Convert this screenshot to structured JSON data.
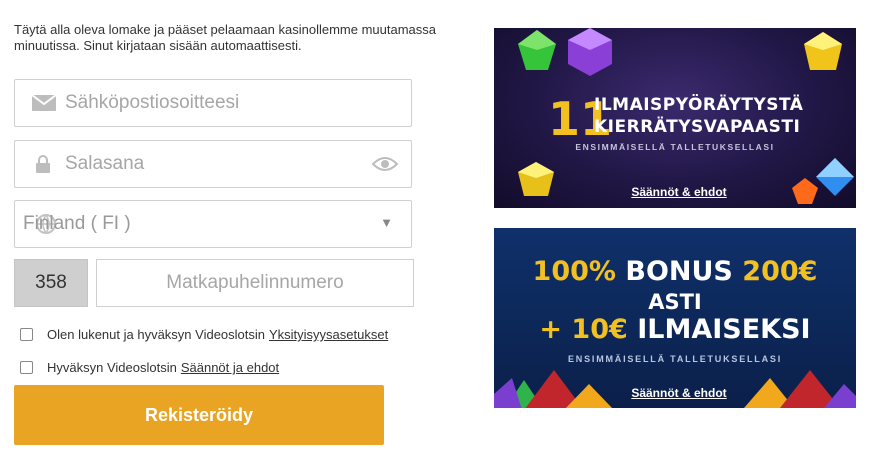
{
  "intro": "Täytä alla oleva lomake ja pääset pelaamaan kasinollemme muutamassa minuutissa. Sinut kirjataan sisään automaattisesti.",
  "form": {
    "email_placeholder": "Sähköpostiosoitteesi",
    "password_placeholder": "Salasana",
    "country_value": "Finland ( FI )",
    "phone_prefix": "358",
    "phone_placeholder": "Matkapuhelinnumero",
    "check1_text": "Olen lukenut ja hyväksyn Videoslotsin",
    "check1_link": "Yksityisyysasetukset",
    "check2_text": "Hyväksyn Videoslotsin",
    "check2_link": "Säännöt ja ehdot",
    "submit_label": "Rekisteröidy"
  },
  "banner1": {
    "number": "11",
    "line1": "ILMAISPYÖRÄYTYSTÄ",
    "line2": "KIERRÄTYSVAPAASTI",
    "sub": "ENSIMMÄISELLÄ TALLETUKSELLASI",
    "terms": "Säännöt & ehdot"
  },
  "banner2": {
    "pct": "100%",
    "bonus": "BONUS",
    "amount": "200€",
    "asti": "ASTI",
    "plus": "+ 10€",
    "free": "ILMAISEKSI",
    "sub": "ENSIMMÄISELLÄ TALLETUKSELLASI",
    "terms": "Säännöt & ehdot"
  },
  "colors": {
    "accent": "#e8a422",
    "gold": "#f2c020"
  }
}
